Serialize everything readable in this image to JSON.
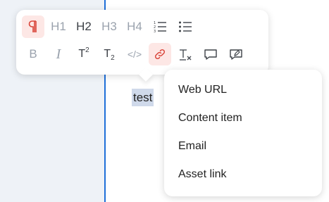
{
  "toolbar": {
    "row1": {
      "paragraph_icon": "pilcrow-icon",
      "h1": "H1",
      "h2": "H2",
      "h3": "H3",
      "h4": "H4",
      "ordered_list_icon": "ordered-list-icon",
      "unordered_list_icon": "unordered-list-icon"
    },
    "row2": {
      "bold": "B",
      "italic": "I",
      "superscript_base": "T",
      "superscript_mark": "2",
      "subscript_base": "T",
      "subscript_mark": "2",
      "code": "</>",
      "link_icon": "link-icon",
      "clear_format_icon": "clear-format-icon",
      "comment_icon": "comment-icon",
      "suggestion_icon": "suggestion-icon"
    }
  },
  "editor": {
    "selected_text": "test"
  },
  "link_menu": {
    "items": [
      "Web URL",
      "Content item",
      "Email",
      "Asset link"
    ]
  },
  "colors": {
    "divider": "#1e6fd9",
    "active_bg": "#fde7e5",
    "active_fg": "#d9453a",
    "selection": "#cfd9ea"
  }
}
